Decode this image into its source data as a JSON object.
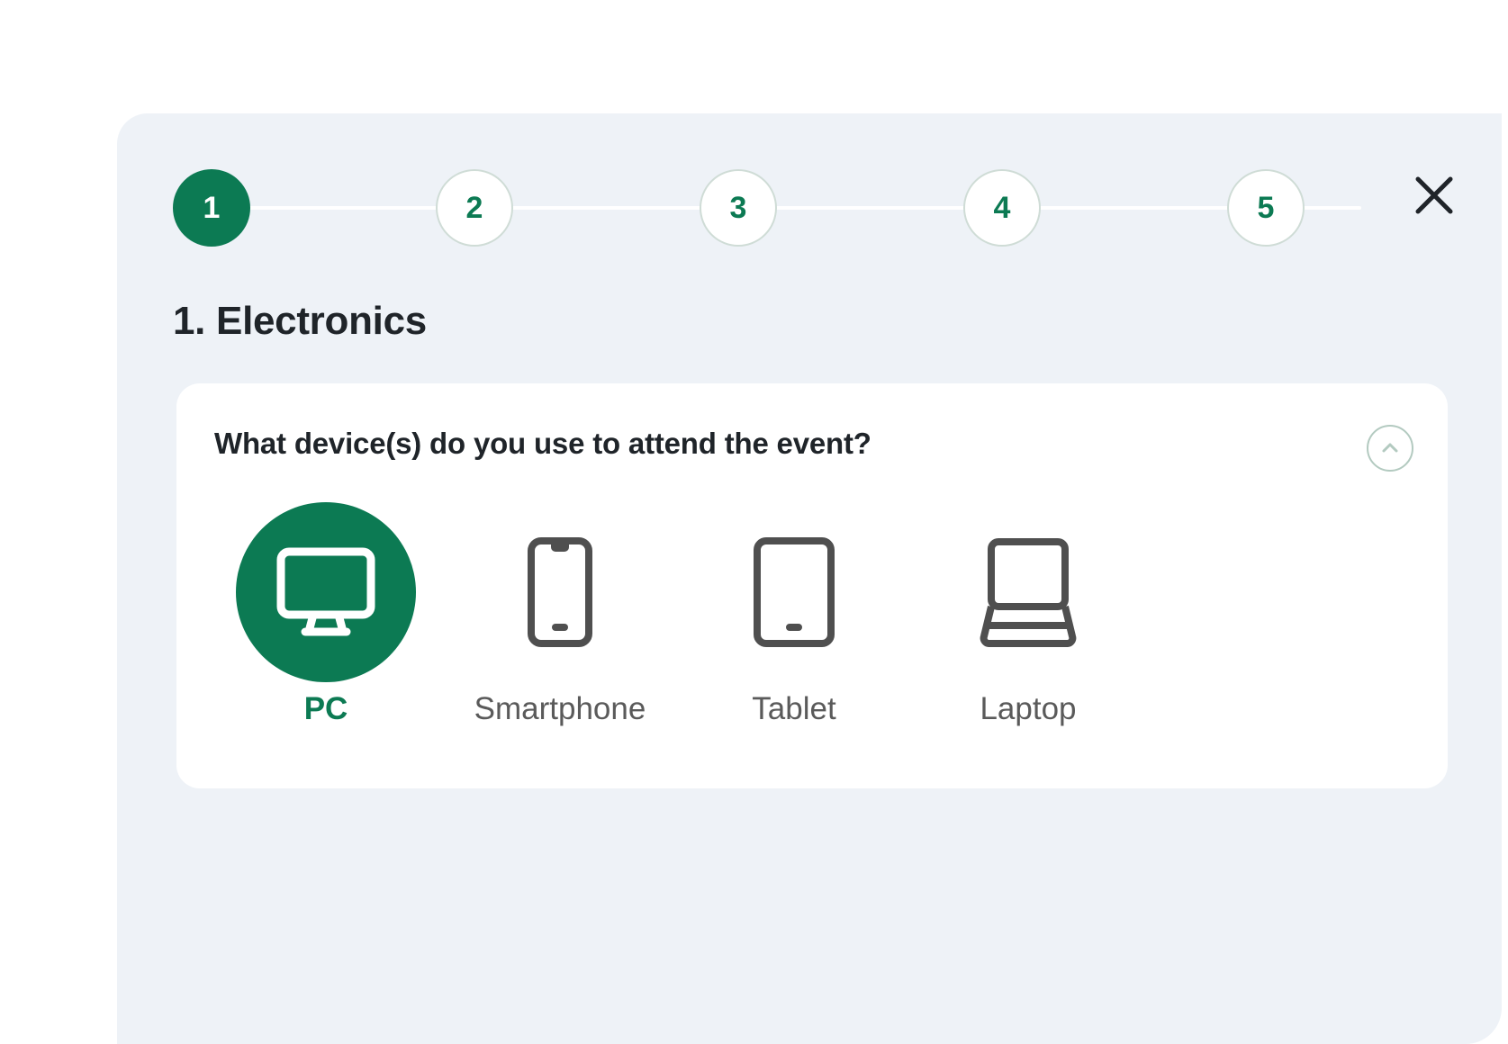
{
  "modal": {
    "stepper": {
      "steps": [
        {
          "number": "1",
          "state": "active"
        },
        {
          "number": "2",
          "state": "inactive"
        },
        {
          "number": "3",
          "state": "inactive"
        },
        {
          "number": "4",
          "state": "inactive"
        },
        {
          "number": "5",
          "state": "inactive"
        }
      ],
      "active_color": "#0c7a53",
      "inactive_border_color": "#cfdcd6",
      "track_color": "#ffffff"
    },
    "close_icon": "close-x-icon",
    "section_title": "1. Electronics",
    "question_card": {
      "question": "What device(s) do you use to attend the event?",
      "collapse_icon": "chevron-up-icon",
      "collapse_icon_color": "#b3cac0",
      "options": [
        {
          "label": "PC",
          "icon": "monitor-icon",
          "selected": true
        },
        {
          "label": "Smartphone",
          "icon": "smartphone-icon",
          "selected": false
        },
        {
          "label": "Tablet",
          "icon": "tablet-icon",
          "selected": false
        },
        {
          "label": "Laptop",
          "icon": "laptop-icon",
          "selected": false
        }
      ]
    }
  },
  "theme": {
    "brand_green": "#0c7a53",
    "panel_background": "#eef2f7",
    "card_background": "#ffffff",
    "text_dark": "#1f2429",
    "icon_gray": "#4f4f4f"
  }
}
